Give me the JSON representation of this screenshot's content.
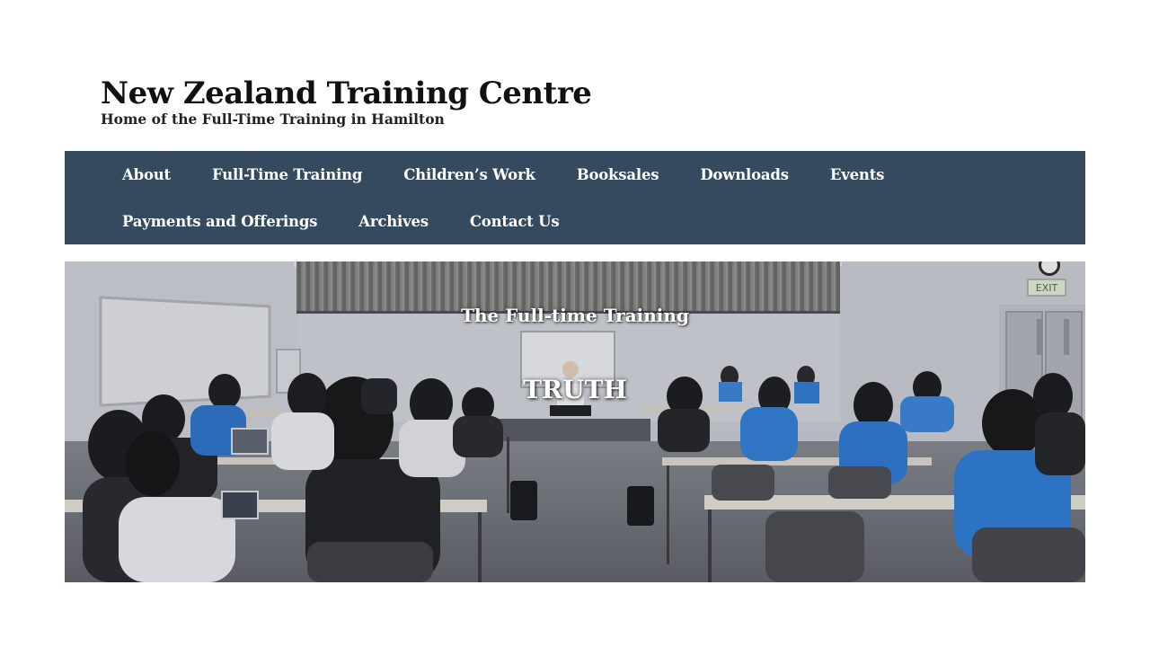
{
  "site": {
    "title": "New Zealand Training Centre",
    "tagline": "Home of the Full-Time Training in Hamilton"
  },
  "nav": {
    "row1": [
      "About",
      "Full-Time Training",
      "Children’s Work",
      "Booksales",
      "Downloads",
      "Events"
    ],
    "row2": [
      "Payments and Offerings",
      "Archives",
      "Contact Us"
    ]
  },
  "hero": {
    "subtitle": "The Full-time Training",
    "title": "TRUTH",
    "exit_sign": "EXIT"
  },
  "colors": {
    "nav_background": "#354a5f",
    "nav_text": "#ffffff",
    "title_text": "#111111"
  }
}
